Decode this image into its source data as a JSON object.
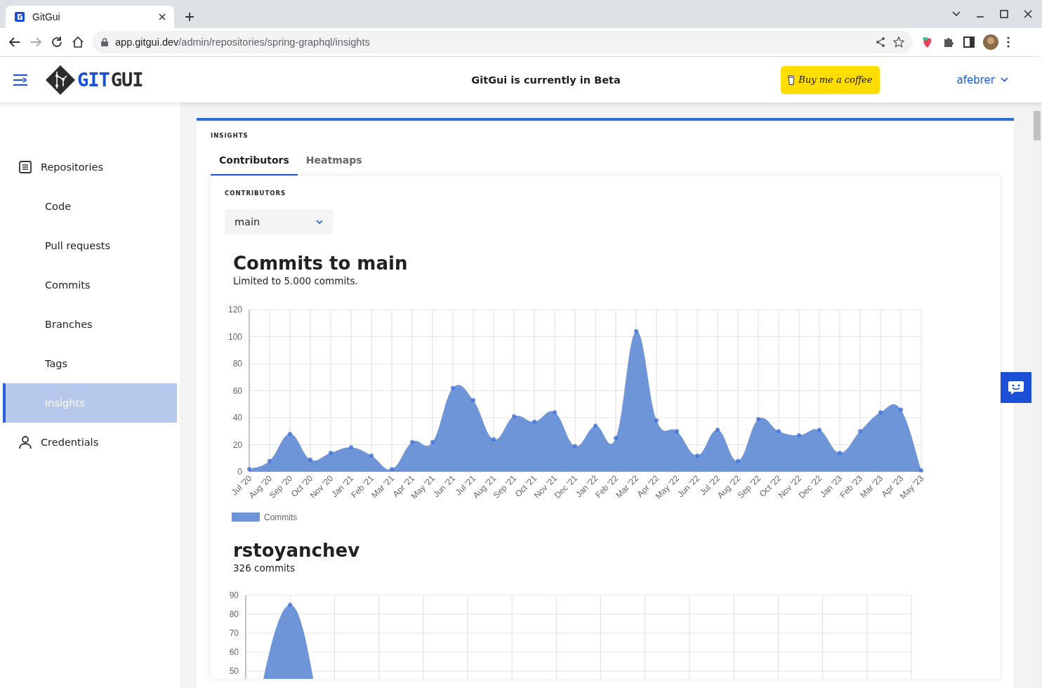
{
  "browser": {
    "tab_title": "GitGui",
    "url_host": "app.gitgui.dev",
    "url_path": "/admin/repositories/spring-graphql/insights"
  },
  "header": {
    "logo_a": "GIT",
    "logo_b": "GUI",
    "notice": "GitGui is currently in Beta",
    "coffee_button": "Buy me a coffee",
    "user": "afebrer"
  },
  "sidebar": {
    "items": [
      {
        "label": "Repositories",
        "kind": "document",
        "selected": false,
        "children": [
          {
            "label": "Code",
            "selected": false
          },
          {
            "label": "Pull requests",
            "selected": false
          },
          {
            "label": "Commits",
            "selected": false
          },
          {
            "label": "Branches",
            "selected": false
          },
          {
            "label": "Tags",
            "selected": false
          },
          {
            "label": "Insights",
            "selected": true
          }
        ]
      },
      {
        "label": "Credentials",
        "kind": "person",
        "selected": false
      }
    ]
  },
  "section_title": "INSIGHTS",
  "tabs": [
    {
      "label": "Contributors",
      "selected": true
    },
    {
      "label": "Heatmaps",
      "selected": false
    }
  ],
  "panel": {
    "title": "CONTRIBUTORS",
    "branch": "main",
    "charts": [
      {
        "title": "Commits to main",
        "subtitle": "Limited to 5.000 commits.",
        "chart_data": {
          "type": "area",
          "grid": true,
          "categories": [
            "Jul '20",
            "Aug '20",
            "Sep '20",
            "Oct '20",
            "Nov '20",
            "Jan '21",
            "Feb '21",
            "Mar '21",
            "Apr '21",
            "May '21",
            "Jun '21",
            "Jul '21",
            "Aug '21",
            "Sep '21",
            "Oct '21",
            "Nov '21",
            "Dec '21",
            "Jan '22",
            "Feb '22",
            "Mar '22",
            "Apr '22",
            "May '22",
            "Jun '22",
            "Jul '22",
            "Aug '22",
            "Sep '22",
            "Oct '22",
            "Nov '22",
            "Dec '22",
            "Jan '23",
            "Feb '23",
            "Mar '23",
            "Apr '23",
            "May '23"
          ],
          "ylim": [
            0,
            120
          ],
          "yticks": [
            0,
            20,
            40,
            60,
            80,
            100,
            120
          ],
          "series": [
            {
              "name": "Commits",
              "color": "#6f95d9",
              "values": [
                2,
                8,
                28,
                9,
                14,
                18,
                12,
                2,
                22,
                22,
                62,
                53,
                24,
                41,
                37,
                44,
                19,
                34,
                25,
                104,
                38,
                30,
                12,
                31,
                8,
                39,
                30,
                27,
                31,
                14,
                30,
                44,
                46,
                1
              ]
            }
          ]
        }
      },
      {
        "title": "rstoyanchev",
        "subtitle": "326 commits",
        "chart_data": {
          "type": "area",
          "grid": true,
          "ylim": [
            0,
            90
          ],
          "yticks": [
            50,
            60,
            70,
            80,
            90
          ],
          "series": [
            {
              "color": "#6f95d9",
              "values": [
                0,
                85,
                0,
                0,
                0,
                0,
                0,
                0,
                0,
                0,
                0,
                0,
                0,
                0,
                0,
                0
              ]
            }
          ]
        }
      }
    ]
  }
}
